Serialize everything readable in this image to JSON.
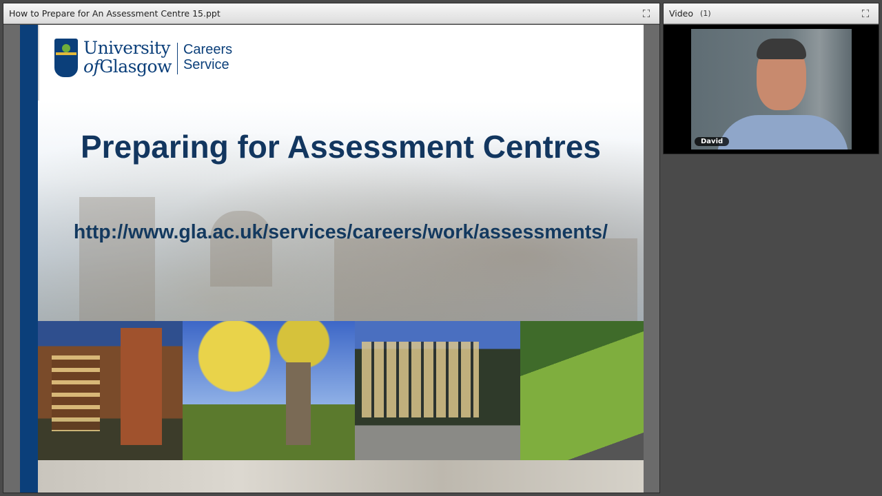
{
  "share_pod": {
    "title": "How to Prepare for An Assessment Centre 15.ppt",
    "expand_icon": "expand-icon"
  },
  "slide": {
    "logo": {
      "line1": "University",
      "line2_of": "of",
      "line2": "Glasgow",
      "unit_line1": "Careers",
      "unit_line2": "Service"
    },
    "title": "Preparing for Assessment Centres",
    "url": "http://www.gla.ac.uk/services/careers/work/assessments/"
  },
  "video_pod": {
    "title": "Video",
    "count": "(1)",
    "participant_name": "David",
    "expand_icon": "expand-icon"
  },
  "colors": {
    "brand_blue": "#0b3f7a",
    "title_blue": "#12365f",
    "titlebar_bg": "#e6e6e6"
  }
}
